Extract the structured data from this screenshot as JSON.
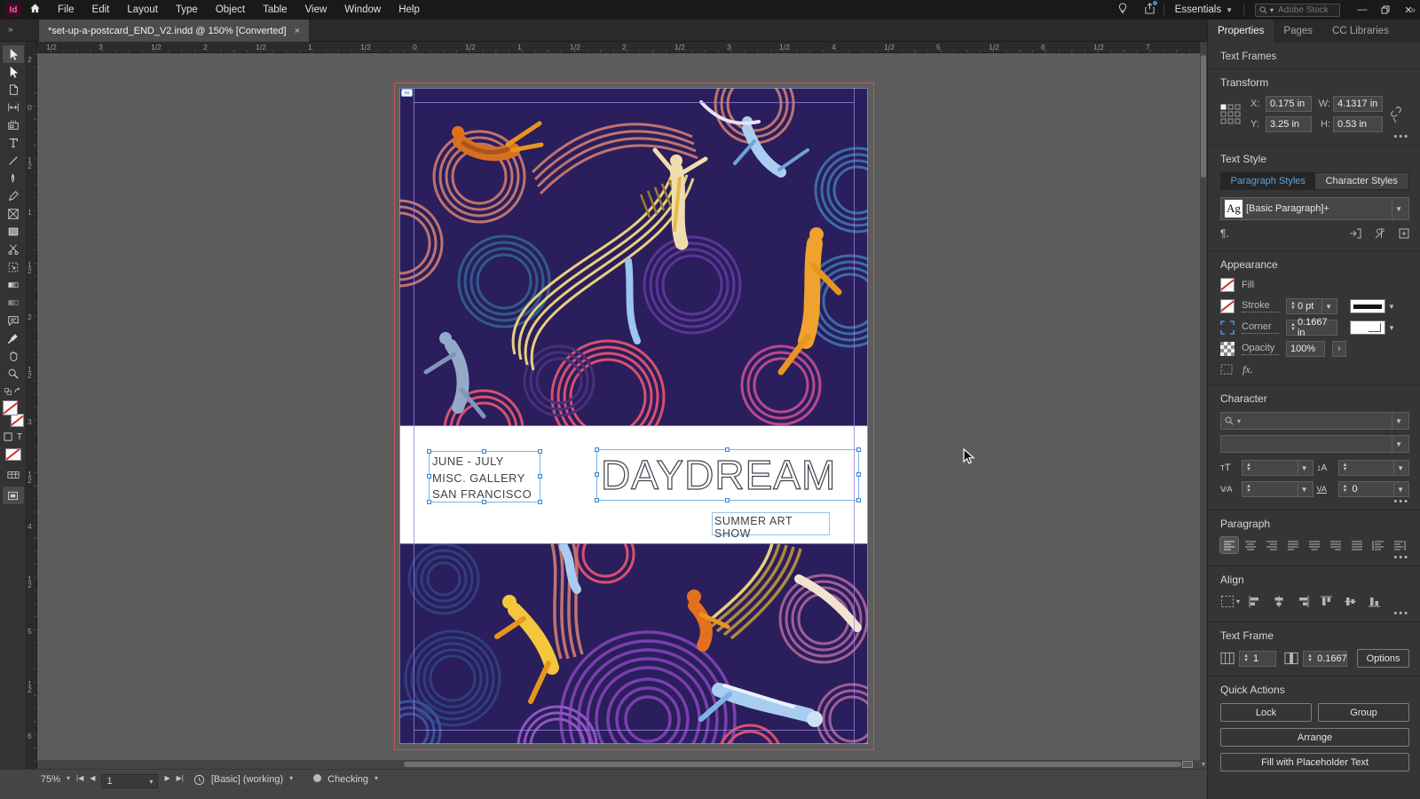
{
  "app": {
    "logo": "Id",
    "menus": [
      "File",
      "Edit",
      "Layout",
      "Type",
      "Object",
      "Table",
      "View",
      "Window",
      "Help"
    ],
    "workspace": "Essentials",
    "search_placeholder": "Adobe Stock"
  },
  "tab": {
    "title": "*set-up-a-postcard_END_V2.indd @ 150% [Converted]",
    "close": "×"
  },
  "rulers": {
    "horizontal": [
      "1/2",
      "3",
      "1/2",
      "2",
      "1/2",
      "1",
      "1/2",
      "0",
      "1/2",
      "1",
      "1/2",
      "2",
      "1/2",
      "3",
      "1/2",
      "4",
      "1/2",
      "5",
      "1/2",
      "6",
      "1/2",
      "7"
    ],
    "vertical": [
      "2",
      "0",
      "1/2",
      "1",
      "1/2",
      "2",
      "1/2",
      "3",
      "1/2",
      "4",
      "1/2",
      "5",
      "1/2",
      "6"
    ]
  },
  "canvas": {
    "info_line1": "JUNE - JULY",
    "info_line2": "MISC. GALLERY",
    "info_line3": "SAN FRANCISCO",
    "title": "DAYDREAM",
    "subtitle": "SUMMER ART SHOW"
  },
  "panel": {
    "tabs": [
      "Properties",
      "Pages",
      "CC Libraries"
    ],
    "selection_type": "Text Frames",
    "transform": {
      "heading": "Transform",
      "x_label": "X:",
      "x": "0.175 in",
      "y_label": "Y:",
      "y": "3.25 in",
      "w_label": "W:",
      "w": "4.1317 in",
      "h_label": "H:",
      "h": "0.53 in"
    },
    "text_style": {
      "heading": "Text Style",
      "paragraph_tab": "Paragraph Styles",
      "character_tab": "Character Styles",
      "style_sample": "Ag",
      "style_name": "[Basic Paragraph]+",
      "pilcrow": "¶."
    },
    "appearance": {
      "heading": "Appearance",
      "fill": "Fill",
      "stroke": "Stroke",
      "stroke_weight": "0 pt",
      "corner": "Corner",
      "corner_radius": "0.1667 in",
      "opacity": "Opacity",
      "opacity_value": "100%",
      "fx": "fx."
    },
    "character": {
      "heading": "Character",
      "tracking_value": "0"
    },
    "paragraph": {
      "heading": "Paragraph"
    },
    "align": {
      "heading": "Align"
    },
    "text_frame": {
      "heading": "Text Frame",
      "columns": "1",
      "gutter": "0.1667",
      "options": "Options"
    },
    "quick_actions": {
      "heading": "Quick Actions",
      "lock": "Lock",
      "group": "Group",
      "arrange": "Arrange",
      "fill_placeholder": "Fill with Placeholder Text"
    }
  },
  "status": {
    "zoom": "75%",
    "page": "1",
    "preflight": "[Basic] (working)",
    "spell_status": "Checking"
  },
  "colors": {
    "accent_blue": "#5ea3d8",
    "selection_blue": "#3d85cc",
    "art_background": "#2a1e5c"
  }
}
